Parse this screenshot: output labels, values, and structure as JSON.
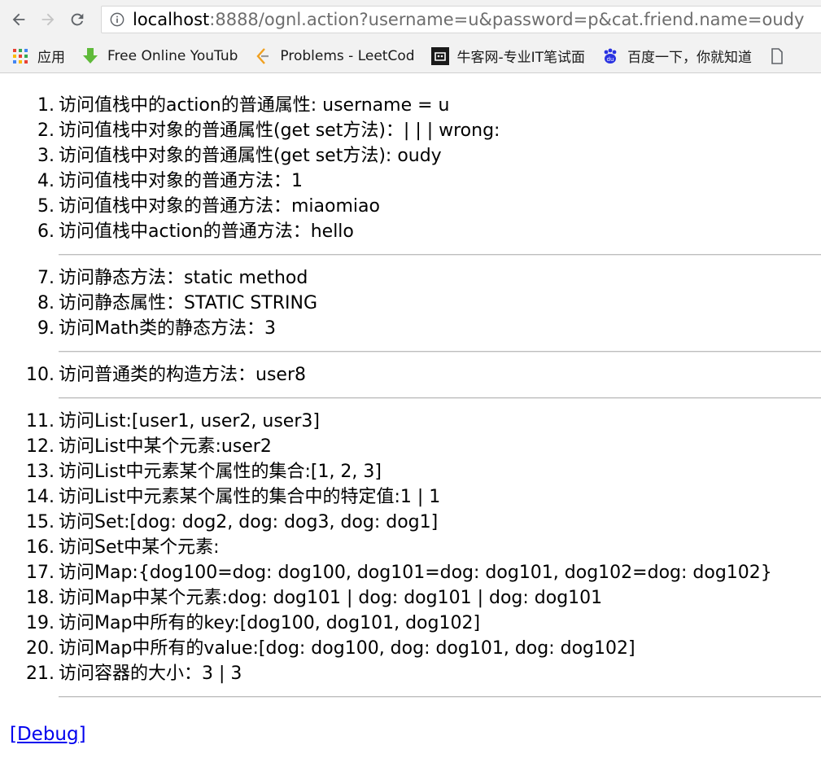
{
  "browser": {
    "url_host": "localhost",
    "url_rest": ":8888/ognl.action?username=u&password=p&cat.friend.name=oudy",
    "bookmarks": [
      {
        "label": "应用",
        "icon": "apps-grid-icon"
      },
      {
        "label": "Free Online YouTub",
        "icon": "download-arrow-icon"
      },
      {
        "label": "Problems - LeetCod",
        "icon": "leetcode-icon"
      },
      {
        "label": "牛客网-专业IT笔试面",
        "icon": "nowcoder-icon"
      },
      {
        "label": "百度一下，你就知道",
        "icon": "baidu-paw-icon"
      }
    ]
  },
  "groups": [
    {
      "items": [
        {
          "num": "1.",
          "text": "访问值栈中的action的普通属性: username = u"
        },
        {
          "num": "2.",
          "text": "访问值栈中对象的普通属性(get set方法)：| | | wrong:"
        },
        {
          "num": "3.",
          "text": "访问值栈中对象的普通属性(get set方法): oudy"
        },
        {
          "num": "4.",
          "text": "访问值栈中对象的普通方法：1"
        },
        {
          "num": "5.",
          "text": "访问值栈中对象的普通方法：miaomiao"
        },
        {
          "num": "6.",
          "text": "访问值栈中action的普通方法：hello"
        }
      ]
    },
    {
      "items": [
        {
          "num": "7.",
          "text": "访问静态方法：static method"
        },
        {
          "num": "8.",
          "text": "访问静态属性：STATIC STRING"
        },
        {
          "num": "9.",
          "text": "访问Math类的静态方法：3"
        }
      ]
    },
    {
      "items": [
        {
          "num": "10.",
          "text": "访问普通类的构造方法：user8"
        }
      ]
    },
    {
      "items": [
        {
          "num": "11.",
          "text": "访问List:[user1, user2, user3]"
        },
        {
          "num": "12.",
          "text": "访问List中某个元素:user2"
        },
        {
          "num": "13.",
          "text": "访问List中元素某个属性的集合:[1, 2, 3]"
        },
        {
          "num": "14.",
          "text": "访问List中元素某个属性的集合中的特定值:1 | 1"
        },
        {
          "num": "15.",
          "text": "访问Set:[dog: dog2, dog: dog3, dog: dog1]"
        },
        {
          "num": "16.",
          "text": "访问Set中某个元素:"
        },
        {
          "num": "17.",
          "text": "访问Map:{dog100=dog: dog100, dog101=dog: dog101, dog102=dog: dog102}"
        },
        {
          "num": "18.",
          "text": "访问Map中某个元素:dog: dog101 | dog: dog101 | dog: dog101"
        },
        {
          "num": "19.",
          "text": "访问Map中所有的key:[dog100, dog101, dog102]"
        },
        {
          "num": "20.",
          "text": "访问Map中所有的value:[dog: dog100, dog: dog101, dog: dog102]"
        },
        {
          "num": "21.",
          "text": "访问容器的大小：3 | 3"
        }
      ]
    }
  ],
  "debug_link": "[Debug]"
}
